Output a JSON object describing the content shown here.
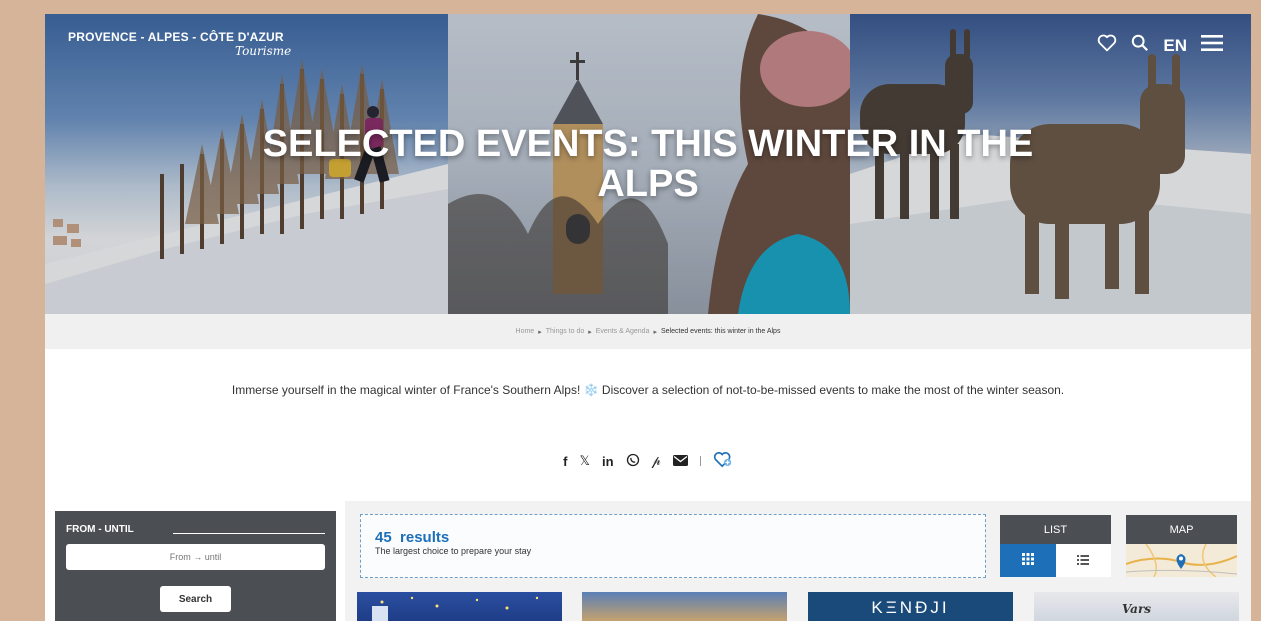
{
  "header": {
    "logo_main": "PROVENCE - ALPES - CÔTE D'AZUR",
    "logo_sub": "Tourisme",
    "language": "EN"
  },
  "hero": {
    "title": "SELECTED EVENTS: THIS WINTER IN THE ALPS"
  },
  "breadcrumb": {
    "items": [
      "Home",
      "Things to do",
      "Events & Agenda"
    ],
    "current": "Selected events: this winter in the Alps"
  },
  "intro": {
    "text": "Immerse yourself in the magical winter of France's Southern Alps! ❄️ Discover a selection of not-to-be-missed events to make the most of the winter season."
  },
  "share": {
    "icons": [
      "facebook-icon",
      "x-icon",
      "linkedin-icon",
      "whatsapp-icon",
      "pinterest-icon",
      "email-icon",
      "favorite-add-icon"
    ]
  },
  "filters": {
    "date_label": "FROM - UNTIL",
    "date_placeholder": "From → until",
    "search_label": "Search"
  },
  "results": {
    "count": "45  results",
    "subtitle": "The largest choice to prepare your stay"
  },
  "view": {
    "list_label": "LIST",
    "map_label": "MAP"
  },
  "cards": {
    "brand_3": "KΞNÐJI",
    "brand_4": "Vars"
  },
  "colors": {
    "accent_blue": "#1d6fb8",
    "dark_panel": "#4b4f54",
    "page_bg": "#d6b49a"
  }
}
